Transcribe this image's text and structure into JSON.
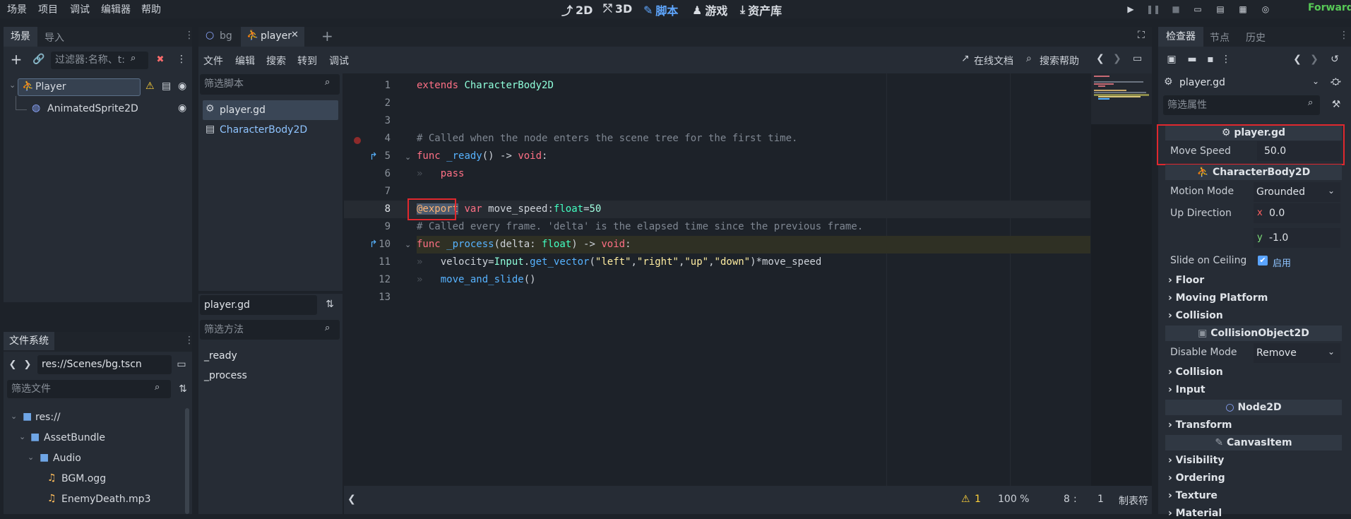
{
  "menu": [
    "场景",
    "项目",
    "调试",
    "编辑器",
    "帮助"
  ],
  "workspaces": [
    {
      "label": "2D",
      "icon": "2d-icon"
    },
    {
      "label": "3D",
      "icon": "3d-icon"
    },
    {
      "label": "脚本",
      "icon": "script-icon"
    },
    {
      "label": "游戏",
      "icon": "game-icon"
    },
    {
      "label": "资产库",
      "icon": "assetlib-icon"
    }
  ],
  "renderer": "Forward+",
  "scene_dock": {
    "tabs": [
      "场景",
      "导入"
    ],
    "filter_placeholder": "过滤器:名称、t:",
    "nodes": [
      {
        "name": "Player"
      },
      {
        "name": "AnimatedSprite2D"
      }
    ]
  },
  "filesystem": {
    "title": "文件系统",
    "path": "res://Scenes/bg.tscn",
    "filter_placeholder": "筛选文件",
    "items": [
      "res://",
      "AssetBundle",
      "Audio",
      "BGM.ogg",
      "EnemyDeath.mp3"
    ]
  },
  "editor_tabs": [
    "bg",
    "player"
  ],
  "script_menu": [
    "文件",
    "编辑",
    "搜索",
    "转到",
    "调试"
  ],
  "online_docs": "在线文档",
  "search_help": "搜索帮助",
  "script_list": {
    "filter_placeholder": "筛选脚本",
    "items": [
      "player.gd",
      "CharacterBody2D"
    ],
    "current": "player.gd",
    "methods_filter_placeholder": "筛选方法",
    "methods": [
      "_ready",
      "_process"
    ]
  },
  "code_lines": [
    "1",
    "2",
    "3",
    "4",
    "5",
    "6",
    "7",
    "8",
    "9",
    "10",
    "11",
    "12",
    "13"
  ],
  "status": {
    "warnings": "1",
    "zoom": "100 %",
    "line": "8",
    "col": "1",
    "indent": "制表符"
  },
  "inspector": {
    "tabs": [
      "检查器",
      "节点",
      "历史"
    ],
    "resource": "player.gd",
    "filter_placeholder": "筛选属性",
    "script_section": "player.gd",
    "move_speed_label": "Move Speed",
    "move_speed_value": "50.0",
    "cb_section": "CharacterBody2D",
    "motion_mode_label": "Motion Mode",
    "motion_mode_value": "Grounded",
    "up_direction_label": "Up Direction",
    "up_x_axis": "x",
    "up_x": "0.0",
    "up_y_axis": "y",
    "up_y": "-1.0",
    "slide_label": "Slide on Ceiling",
    "slide_value": "启用",
    "groups1": [
      "Floor",
      "Moving Platform",
      "Collision"
    ],
    "co_section": "CollisionObject2D",
    "disable_mode_label": "Disable Mode",
    "disable_mode_value": "Remove",
    "groups2": [
      "Collision",
      "Input"
    ],
    "n2d_section": "Node2D",
    "groups3": [
      "Transform"
    ],
    "ci_section": "CanvasItem",
    "groups4": [
      "Visibility",
      "Ordering",
      "Texture",
      "Material"
    ]
  }
}
